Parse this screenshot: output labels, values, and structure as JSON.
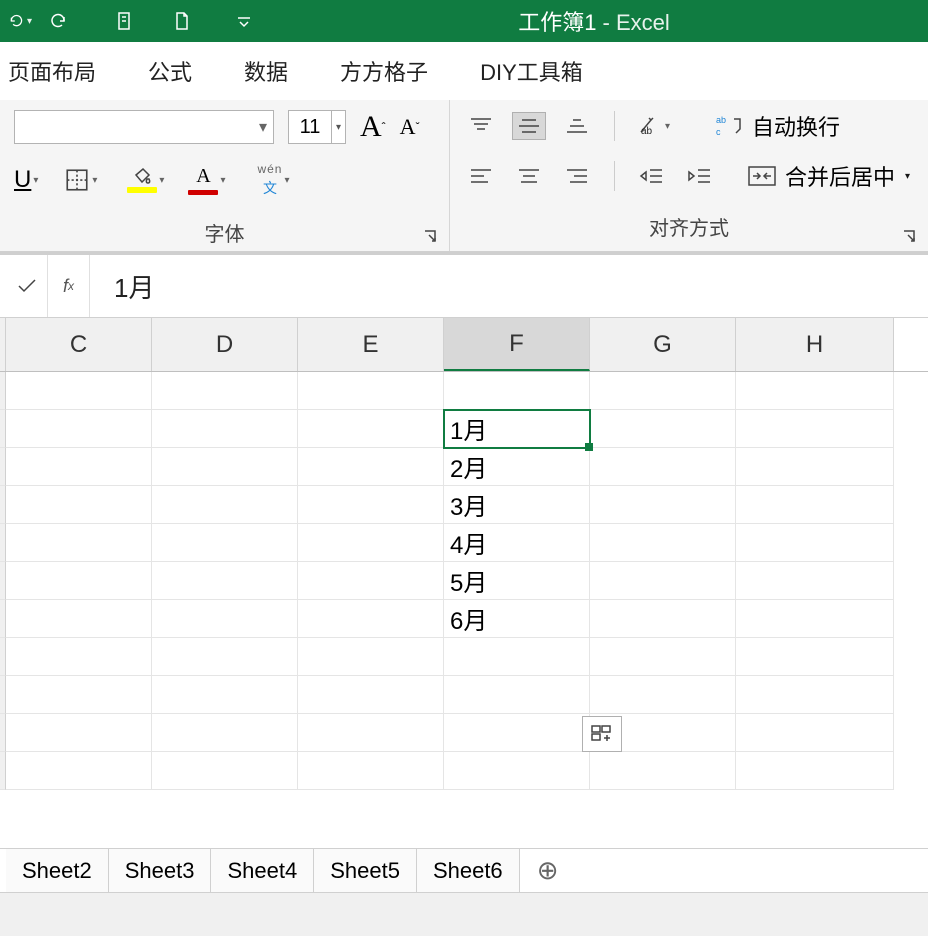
{
  "title": {
    "doc": "工作簿1",
    "sep": " - ",
    "app": "Excel"
  },
  "tabs": [
    "页面布局",
    "公式",
    "数据",
    "方方格子",
    "DIY工具箱"
  ],
  "font_group": {
    "label": "字体",
    "size": "11",
    "increase_icon": "A",
    "decrease_icon": "A",
    "underline": "U",
    "wen_top": "wén",
    "wen_bottom": "文",
    "fill_color": "#ffff00",
    "font_color": "#d00000",
    "font_letter": "A",
    "bucket_letter": ""
  },
  "align_group": {
    "label": "对齐方式",
    "wrap": "自动换行",
    "merge": "合并后居中",
    "orientation_icon": "orientation"
  },
  "formula_bar": {
    "value": "1月"
  },
  "columns": [
    "C",
    "D",
    "E",
    "F",
    "G",
    "H"
  ],
  "selected_col_index": 3,
  "cells": {
    "F2": "1月",
    "F3": "2月",
    "F4": "3月",
    "F5": "4月",
    "F6": "5月",
    "F7": "6月"
  },
  "selected_cell": "F2",
  "sheets": [
    "Sheet2",
    "Sheet3",
    "Sheet4",
    "Sheet5",
    "Sheet6"
  ],
  "icons": {
    "undo": "undo-icon",
    "redo": "redo-icon",
    "print": "print-preview-icon",
    "new": "new-file-icon",
    "more": "more-icon"
  }
}
